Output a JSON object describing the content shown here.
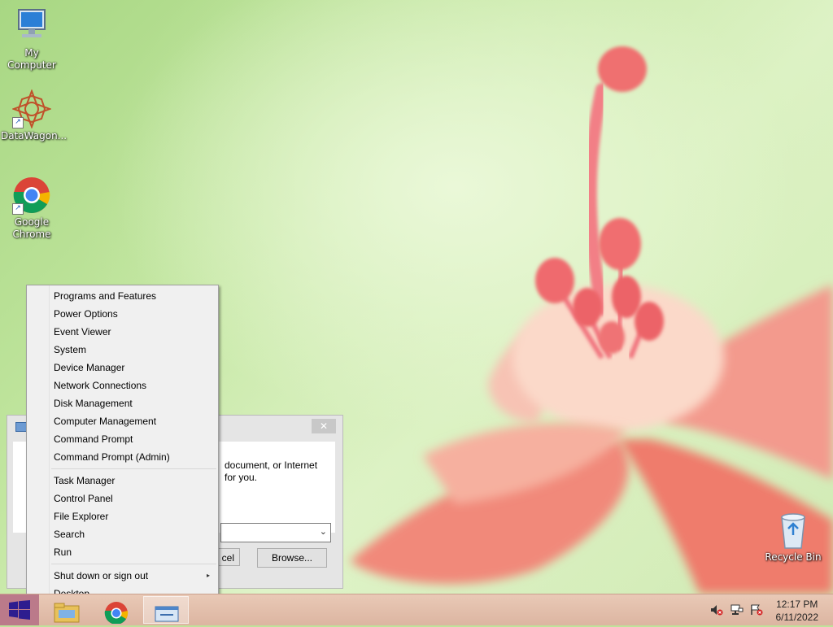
{
  "desktop": {
    "icons": [
      {
        "label": "My Computer"
      },
      {
        "label": "DataWagon..."
      },
      {
        "label": "Google Chrome"
      },
      {
        "label": "Recycle Bin"
      }
    ]
  },
  "run_dialog": {
    "close_glyph": "✕",
    "description_line1": "document, or Internet",
    "description_line2": "for you.",
    "cancel_label_fragment": "cel",
    "browse_label": "Browse..."
  },
  "winx_menu": {
    "items": [
      {
        "label": "Programs and Features"
      },
      {
        "label": "Power Options"
      },
      {
        "label": "Event Viewer"
      },
      {
        "label": "System"
      },
      {
        "label": "Device Manager"
      },
      {
        "label": "Network Connections"
      },
      {
        "label": "Disk Management"
      },
      {
        "label": "Computer Management"
      },
      {
        "label": "Command Prompt"
      },
      {
        "label": "Command Prompt (Admin)"
      },
      {
        "label": "Task Manager"
      },
      {
        "label": "Control Panel"
      },
      {
        "label": "File Explorer"
      },
      {
        "label": "Search"
      },
      {
        "label": "Run"
      },
      {
        "label": "Shut down or sign out"
      },
      {
        "label": "Desktop"
      }
    ],
    "submenu_glyph": "▸"
  },
  "taskbar": {
    "clock_time": "12:17 PM",
    "clock_date": "6/11/2022",
    "apps": [
      "file-explorer",
      "google-chrome",
      "run"
    ]
  },
  "colors": {
    "start_button": "#bb7a8a",
    "taskbar": "#e2bfab",
    "menu_bg": "#f0f0f0"
  }
}
